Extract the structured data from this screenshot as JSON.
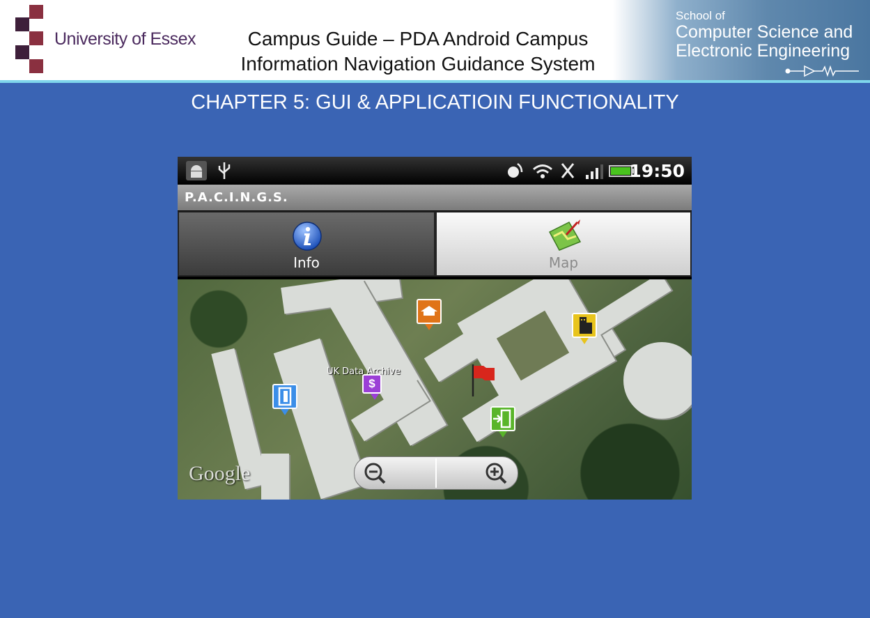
{
  "header": {
    "university": "University of Essex",
    "title_line1": "Campus Guide – PDA Android Campus",
    "title_line2": "Information Navigation Guidance System",
    "school_small": "School of",
    "school_line1": "Computer Science and",
    "school_line2": "Electronic Engineering",
    "brand_color": "#7a2a3a"
  },
  "slide": {
    "heading": "CHAPTER 5: GUI & APPLICATIOIN FUNCTIONALITY",
    "background": "#3a64b4"
  },
  "phone": {
    "status": {
      "time": "19:50",
      "icons": [
        "android-icon",
        "usb-icon",
        "gps-icon",
        "wifi-icon",
        "no-sim-icon",
        "signal-icon",
        "battery-icon"
      ]
    },
    "app_title": "P.A.C.I.N.G.S.",
    "tabs": [
      {
        "label": "Info",
        "icon": "info-icon",
        "selected": false
      },
      {
        "label": "Map",
        "icon": "map-icon",
        "selected": true
      }
    ],
    "map": {
      "label": "UK Data Archive",
      "attribution": "Google",
      "markers": [
        "graduation-marker",
        "building-marker",
        "flag-marker",
        "money-marker",
        "door-marker",
        "entrance-marker"
      ]
    }
  }
}
